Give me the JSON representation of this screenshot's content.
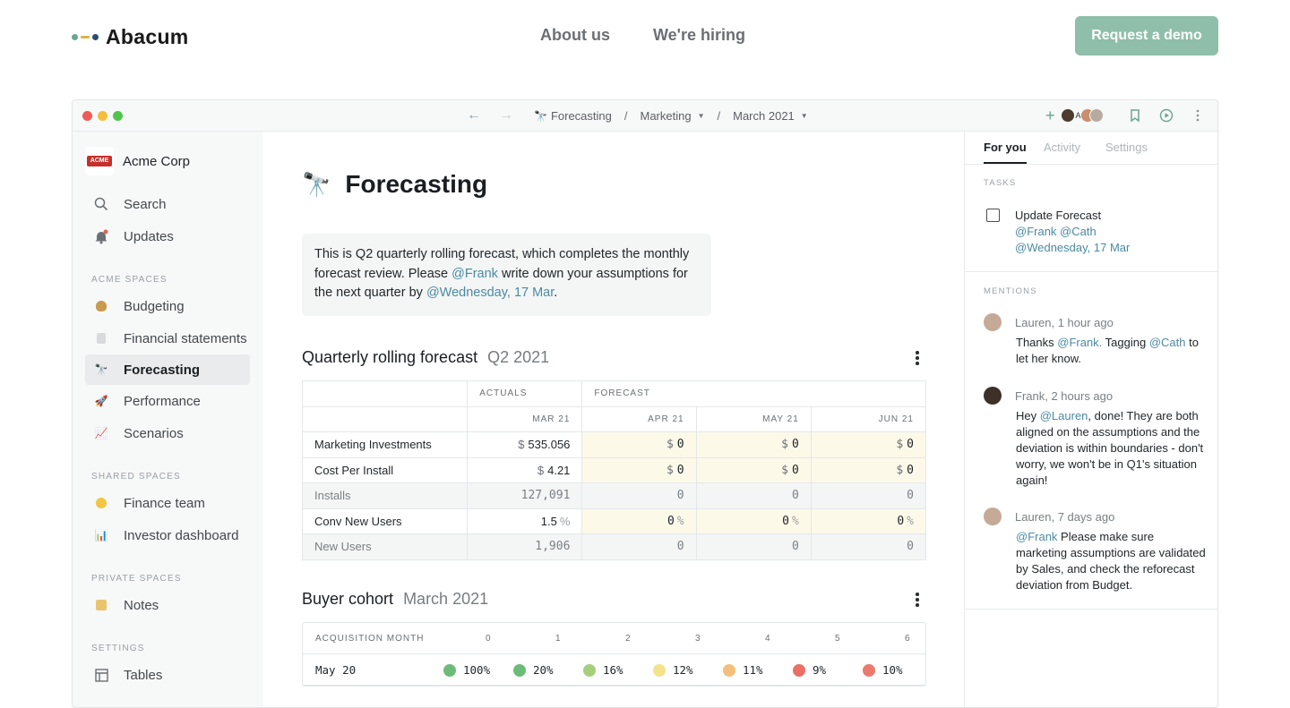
{
  "site": {
    "brand": "Abacum",
    "nav": [
      "About us",
      "We're hiring"
    ],
    "cta": "Request a demo",
    "colors": {
      "accent": "#8fbfaa",
      "mention": "#4b8aa3"
    }
  },
  "window": {
    "breadcrumb": {
      "page": "Forecasting",
      "space": "Marketing",
      "period": "March 2021"
    },
    "collaborator_initial": "A"
  },
  "sidebar": {
    "org": "Acme Corp",
    "org_logo_text": "ACME",
    "top_items": [
      {
        "label": "Search",
        "icon": "search-icon"
      },
      {
        "label": "Updates",
        "icon": "bell-icon"
      }
    ],
    "sections": [
      {
        "heading": "ACME SPACES",
        "items": [
          "Budgeting",
          "Financial statements",
          "Forecasting",
          "Performance",
          "Scenarios"
        ]
      },
      {
        "heading": "SHARED SPACES",
        "items": [
          "Finance team",
          "Investor dashboard"
        ]
      },
      {
        "heading": "PRIVATE SPACES",
        "items": [
          "Notes"
        ]
      },
      {
        "heading": "SETTINGS",
        "items": [
          "Tables"
        ]
      }
    ],
    "active": "Forecasting"
  },
  "main": {
    "title": "Forecasting",
    "callout": {
      "p1": "This is Q2 quarterly rolling forecast, which completes the monthly forecast review. Please ",
      "m1": "@Frank",
      "p2": " write down your assumptions for the next quarter by ",
      "m2": "@Wednesday, 17 Mar",
      "p3": "."
    },
    "forecast_table": {
      "title": "Quarterly rolling forecast",
      "period": "Q2 2021",
      "group_actuals": "ACTUALS",
      "group_forecast": "FORECAST",
      "months": [
        "MAR 21",
        "APR 21",
        "MAY 21",
        "JUN 21"
      ],
      "rows": [
        {
          "label": "Marketing Investments",
          "prefix": "$",
          "suffix": "",
          "values": [
            "535.056",
            "0",
            "0",
            "0"
          ],
          "computed": false
        },
        {
          "label": "Cost Per Install",
          "prefix": "$",
          "suffix": "",
          "values": [
            "4.21",
            "0",
            "0",
            "0"
          ],
          "computed": false
        },
        {
          "label": "Installs",
          "prefix": "",
          "suffix": "",
          "values": [
            "127,091",
            "0",
            "0",
            "0"
          ],
          "computed": true
        },
        {
          "label": "Conv New Users",
          "prefix": "",
          "suffix": "%",
          "values": [
            "1.5",
            "0",
            "0",
            "0"
          ],
          "computed": false
        },
        {
          "label": "New Users",
          "prefix": "",
          "suffix": "",
          "values": [
            "1,906",
            "0",
            "0",
            "0"
          ],
          "computed": true
        }
      ]
    },
    "cohort_table": {
      "title": "Buyer cohort",
      "period": "March 2021",
      "first_col": "ACQUISITION MONTH",
      "cols": [
        "0",
        "1",
        "2",
        "3",
        "4",
        "5",
        "6"
      ],
      "rows": [
        {
          "label": "May 20",
          "values": [
            "100%",
            "20%",
            "16%",
            "12%",
            "11%",
            "9%",
            "10%"
          ],
          "colors": [
            "#6dbb78",
            "#6dbb78",
            "#a6cf7c",
            "#f3e38a",
            "#f2c07b",
            "#ea6f66",
            "#ea7a6d"
          ]
        }
      ]
    }
  },
  "right_panel": {
    "tabs": [
      "For you",
      "Activity",
      "Settings"
    ],
    "tasks_heading": "TASKS",
    "task": {
      "title": "Update Forecast",
      "mentions": "@Frank @Cath",
      "due": "@Wednesday, 17 Mar"
    },
    "mentions_heading": "MENTIONS",
    "mentions": [
      {
        "who": "Lauren, 1 hour ago",
        "parts": [
          [
            "Thanks ",
            false
          ],
          [
            "@Frank.",
            true
          ],
          [
            " Tagging ",
            false
          ],
          [
            "@Cath",
            true
          ],
          [
            " to let her know.",
            false
          ]
        ]
      },
      {
        "who": "Frank, 2 hours ago",
        "parts": [
          [
            "Hey ",
            false
          ],
          [
            "@Lauren",
            true
          ],
          [
            ", done! They are both aligned on the assumptions and the deviation is within boundaries - don't worry, we won't be in Q1's situation again!",
            false
          ]
        ]
      },
      {
        "who": "Lauren, 7 days ago",
        "parts": [
          [
            "@Frank",
            true
          ],
          [
            " Please make sure marketing assumptions are validated by Sales, and check the reforecast deviation from Budget.",
            false
          ]
        ]
      }
    ]
  }
}
